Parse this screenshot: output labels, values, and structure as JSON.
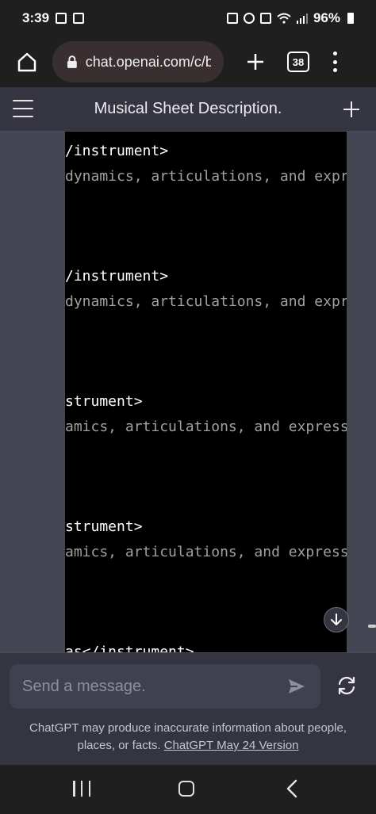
{
  "status_bar": {
    "time": "3:39",
    "battery": "96%"
  },
  "browser": {
    "url": "chat.openai.com/c/b",
    "tab_count": "38"
  },
  "header": {
    "title": "Musical Sheet Description."
  },
  "code_lines": [
    {
      "text": "/instrument>",
      "kind": "tag"
    },
    {
      "text": "dynamics, articulations, and expr",
      "kind": "comment"
    },
    {
      "text": "/instrument>",
      "kind": "tag"
    },
    {
      "text": "dynamics, articulations, and expr",
      "kind": "comment"
    },
    {
      "text": "strument>",
      "kind": "tag"
    },
    {
      "text": "amics, articulations, and express",
      "kind": "comment"
    },
    {
      "text": "strument>",
      "kind": "tag"
    },
    {
      "text": "amics, articulations, and express",
      "kind": "comment"
    },
    {
      "text": "as</instrument>",
      "kind": "tag"
    }
  ],
  "composer": {
    "placeholder": "Send a message."
  },
  "disclaimer": {
    "text": "ChatGPT may produce inaccurate information about people, places, or facts.",
    "link_text": "ChatGPT May 24 Version"
  },
  "colors": {
    "chat_bg": "#444654",
    "header_bg": "#343541",
    "code_bg": "#000000",
    "composer_bg": "#40414f"
  }
}
